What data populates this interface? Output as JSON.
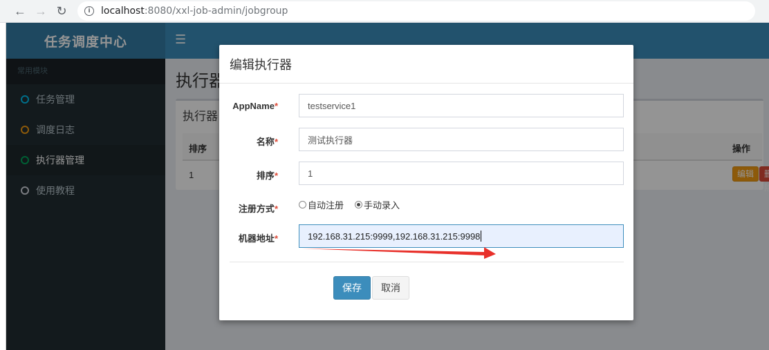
{
  "browser": {
    "url_host": "localhost",
    "url_rest": ":8080/xxl-job-admin/jobgroup"
  },
  "sidebar": {
    "logo": "任务调度中心",
    "header": "常用模块",
    "items": [
      {
        "label": "任务管理",
        "icon_color": "#00c0ef"
      },
      {
        "label": "调度日志",
        "icon_color": "#f39c12"
      },
      {
        "label": "执行器管理",
        "icon_color": "#00a65a"
      },
      {
        "label": "使用教程",
        "icon_color": "#d2d6de"
      }
    ]
  },
  "content": {
    "page_title": "执行器",
    "box_title": "执行器",
    "table": {
      "headers": [
        "排序",
        "操作"
      ],
      "row": {
        "order": "1",
        "edit": "编辑",
        "delete": "删除"
      }
    }
  },
  "modal": {
    "title": "编辑执行器",
    "fields": {
      "appname": {
        "label": "AppName",
        "value": "testservice1"
      },
      "name": {
        "label": "名称",
        "value": "测试执行器"
      },
      "order": {
        "label": "排序",
        "value": "1"
      },
      "reg_type": {
        "label": "注册方式",
        "options": [
          "自动注册",
          "手动录入"
        ],
        "selected": "手动录入"
      },
      "address": {
        "label": "机器地址",
        "value": "192.168.31.215:9999,192.168.31.215:9998"
      }
    },
    "required_mark": "*",
    "save_label": "保存",
    "cancel_label": "取消"
  },
  "colors": {
    "primary": "#3c8dbc",
    "sidebar_bg": "#222d32",
    "edit_btn": "#f39c12",
    "delete_btn": "#dd4b39",
    "annotation_arrow": "#e8302a"
  }
}
